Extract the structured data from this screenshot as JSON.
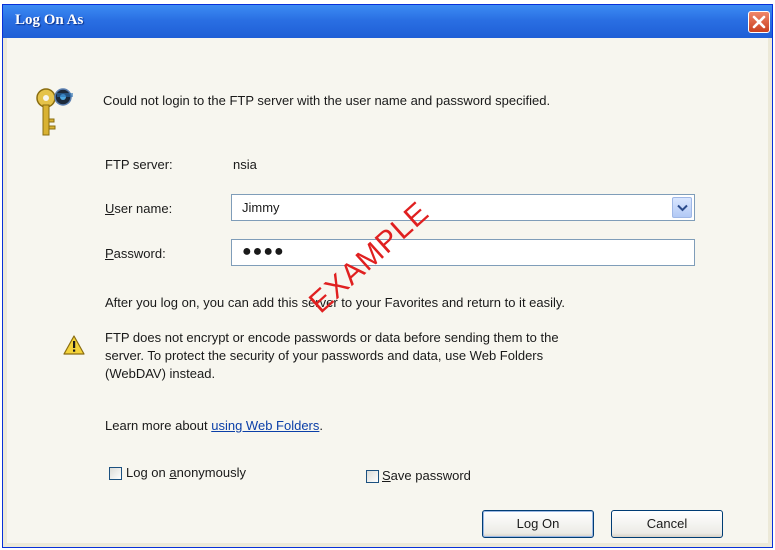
{
  "window": {
    "title": "Log On As"
  },
  "message": "Could not login to the FTP server with the user name and password specified.",
  "ftp_server": {
    "label": "FTP server:",
    "value": "nsia"
  },
  "user_name": {
    "label_prefix": "U",
    "label_rest": "ser name:",
    "value": "Jimmy"
  },
  "password": {
    "label_prefix": "P",
    "label_rest": "assword:",
    "value": "●●●●"
  },
  "info_text": "After you log on, you can add this server to your Favorites and return to it easily.",
  "warning": {
    "line1": "FTP does not encrypt or encode passwords or data before sending them to the",
    "line2": "server.  To protect the security of your passwords and data, use Web Folders",
    "line3": "(WebDAV) instead."
  },
  "learn_more": {
    "prefix": "Learn more about ",
    "link": "using Web Folders",
    "suffix": "."
  },
  "checkboxes": {
    "anonymous": {
      "pre": "Log on ",
      "accel": "a",
      "post": "nonymously",
      "checked": false
    },
    "save_password": {
      "pre": "",
      "accel": "S",
      "post": "ave password",
      "checked": false
    }
  },
  "buttons": {
    "logon": "Log On",
    "cancel": "Cancel"
  },
  "watermark": "EXAMPLE",
  "icons": {
    "keys": "keys-icon",
    "warning": "warning-icon",
    "close": "close-icon",
    "dropdown": "chevron-down-icon"
  }
}
